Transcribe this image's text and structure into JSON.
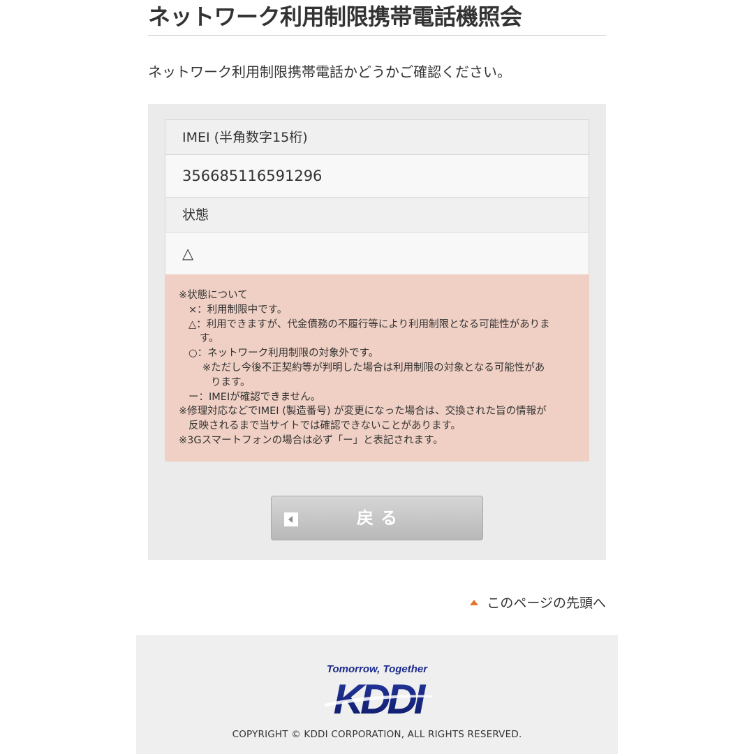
{
  "page": {
    "title": "ネットワーク利用制限携帯電話機照会",
    "lead": "ネットワーク利用制限携帯電話かどうかご確認ください。"
  },
  "result": {
    "imei_label": "IMEI (半角数字15桁)",
    "imei_value": "356685116591296",
    "status_label": "状態",
    "status_value": "△"
  },
  "notes": {
    "lines": [
      "※状態について",
      "×：利用制限中です。",
      "△：利用できますが、代金債務の不履行等により利用制限となる可能性がありま",
      "す。",
      "○：ネットワーク利用制限の対象外です。",
      "※ただし今後不正契約等が判明した場合は利用制限の対象となる可能性があ",
      "ります。",
      "ー：IMEIが確認できません。",
      "※修理対応などでIMEI (製造番号) が変更になった場合は、交換された旨の情報が",
      "反映されるまで当サイトでは確認できないことがあります。",
      "※3Gスマートフォンの場合は必ず「ー」と表記されます。"
    ]
  },
  "actions": {
    "back_label": "戻る",
    "back_icon": "chevron-left-icon"
  },
  "nav": {
    "page_top_label": "このページの先頭へ",
    "page_top_icon": "triangle-up-icon",
    "accent_color": "#e8742a"
  },
  "footer": {
    "tagline": "Tomorrow, Together",
    "brand": "KDDI",
    "brand_color": "#1b2a8c",
    "copyright": "COPYRIGHT © KDDI CORPORATION, ALL RIGHTS RESERVED."
  }
}
